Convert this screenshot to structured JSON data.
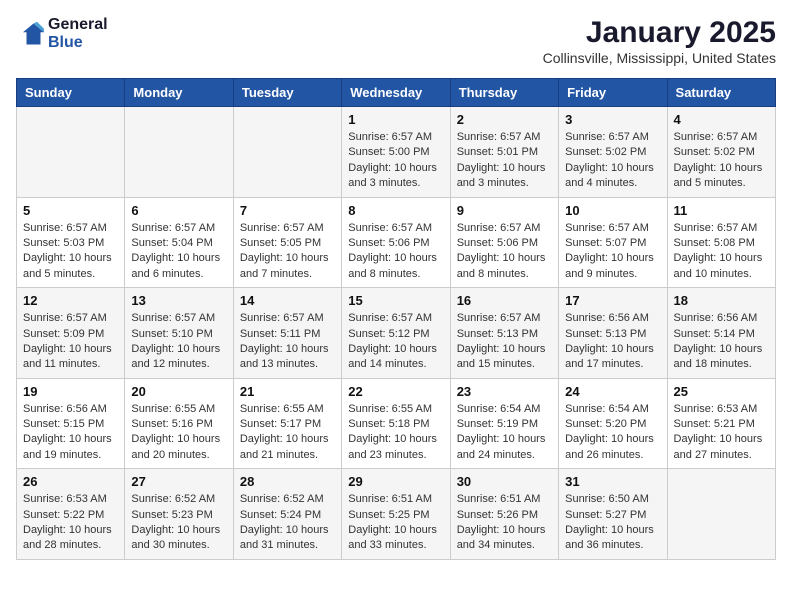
{
  "header": {
    "logo_line1": "General",
    "logo_line2": "Blue",
    "title": "January 2025",
    "subtitle": "Collinsville, Mississippi, United States"
  },
  "days_of_week": [
    "Sunday",
    "Monday",
    "Tuesday",
    "Wednesday",
    "Thursday",
    "Friday",
    "Saturday"
  ],
  "weeks": [
    [
      {
        "num": "",
        "sunrise": "",
        "sunset": "",
        "daylight": ""
      },
      {
        "num": "",
        "sunrise": "",
        "sunset": "",
        "daylight": ""
      },
      {
        "num": "",
        "sunrise": "",
        "sunset": "",
        "daylight": ""
      },
      {
        "num": "1",
        "sunrise": "Sunrise: 6:57 AM",
        "sunset": "Sunset: 5:00 PM",
        "daylight": "Daylight: 10 hours and 3 minutes."
      },
      {
        "num": "2",
        "sunrise": "Sunrise: 6:57 AM",
        "sunset": "Sunset: 5:01 PM",
        "daylight": "Daylight: 10 hours and 3 minutes."
      },
      {
        "num": "3",
        "sunrise": "Sunrise: 6:57 AM",
        "sunset": "Sunset: 5:02 PM",
        "daylight": "Daylight: 10 hours and 4 minutes."
      },
      {
        "num": "4",
        "sunrise": "Sunrise: 6:57 AM",
        "sunset": "Sunset: 5:02 PM",
        "daylight": "Daylight: 10 hours and 5 minutes."
      }
    ],
    [
      {
        "num": "5",
        "sunrise": "Sunrise: 6:57 AM",
        "sunset": "Sunset: 5:03 PM",
        "daylight": "Daylight: 10 hours and 5 minutes."
      },
      {
        "num": "6",
        "sunrise": "Sunrise: 6:57 AM",
        "sunset": "Sunset: 5:04 PM",
        "daylight": "Daylight: 10 hours and 6 minutes."
      },
      {
        "num": "7",
        "sunrise": "Sunrise: 6:57 AM",
        "sunset": "Sunset: 5:05 PM",
        "daylight": "Daylight: 10 hours and 7 minutes."
      },
      {
        "num": "8",
        "sunrise": "Sunrise: 6:57 AM",
        "sunset": "Sunset: 5:06 PM",
        "daylight": "Daylight: 10 hours and 8 minutes."
      },
      {
        "num": "9",
        "sunrise": "Sunrise: 6:57 AM",
        "sunset": "Sunset: 5:06 PM",
        "daylight": "Daylight: 10 hours and 8 minutes."
      },
      {
        "num": "10",
        "sunrise": "Sunrise: 6:57 AM",
        "sunset": "Sunset: 5:07 PM",
        "daylight": "Daylight: 10 hours and 9 minutes."
      },
      {
        "num": "11",
        "sunrise": "Sunrise: 6:57 AM",
        "sunset": "Sunset: 5:08 PM",
        "daylight": "Daylight: 10 hours and 10 minutes."
      }
    ],
    [
      {
        "num": "12",
        "sunrise": "Sunrise: 6:57 AM",
        "sunset": "Sunset: 5:09 PM",
        "daylight": "Daylight: 10 hours and 11 minutes."
      },
      {
        "num": "13",
        "sunrise": "Sunrise: 6:57 AM",
        "sunset": "Sunset: 5:10 PM",
        "daylight": "Daylight: 10 hours and 12 minutes."
      },
      {
        "num": "14",
        "sunrise": "Sunrise: 6:57 AM",
        "sunset": "Sunset: 5:11 PM",
        "daylight": "Daylight: 10 hours and 13 minutes."
      },
      {
        "num": "15",
        "sunrise": "Sunrise: 6:57 AM",
        "sunset": "Sunset: 5:12 PM",
        "daylight": "Daylight: 10 hours and 14 minutes."
      },
      {
        "num": "16",
        "sunrise": "Sunrise: 6:57 AM",
        "sunset": "Sunset: 5:13 PM",
        "daylight": "Daylight: 10 hours and 15 minutes."
      },
      {
        "num": "17",
        "sunrise": "Sunrise: 6:56 AM",
        "sunset": "Sunset: 5:13 PM",
        "daylight": "Daylight: 10 hours and 17 minutes."
      },
      {
        "num": "18",
        "sunrise": "Sunrise: 6:56 AM",
        "sunset": "Sunset: 5:14 PM",
        "daylight": "Daylight: 10 hours and 18 minutes."
      }
    ],
    [
      {
        "num": "19",
        "sunrise": "Sunrise: 6:56 AM",
        "sunset": "Sunset: 5:15 PM",
        "daylight": "Daylight: 10 hours and 19 minutes."
      },
      {
        "num": "20",
        "sunrise": "Sunrise: 6:55 AM",
        "sunset": "Sunset: 5:16 PM",
        "daylight": "Daylight: 10 hours and 20 minutes."
      },
      {
        "num": "21",
        "sunrise": "Sunrise: 6:55 AM",
        "sunset": "Sunset: 5:17 PM",
        "daylight": "Daylight: 10 hours and 21 minutes."
      },
      {
        "num": "22",
        "sunrise": "Sunrise: 6:55 AM",
        "sunset": "Sunset: 5:18 PM",
        "daylight": "Daylight: 10 hours and 23 minutes."
      },
      {
        "num": "23",
        "sunrise": "Sunrise: 6:54 AM",
        "sunset": "Sunset: 5:19 PM",
        "daylight": "Daylight: 10 hours and 24 minutes."
      },
      {
        "num": "24",
        "sunrise": "Sunrise: 6:54 AM",
        "sunset": "Sunset: 5:20 PM",
        "daylight": "Daylight: 10 hours and 26 minutes."
      },
      {
        "num": "25",
        "sunrise": "Sunrise: 6:53 AM",
        "sunset": "Sunset: 5:21 PM",
        "daylight": "Daylight: 10 hours and 27 minutes."
      }
    ],
    [
      {
        "num": "26",
        "sunrise": "Sunrise: 6:53 AM",
        "sunset": "Sunset: 5:22 PM",
        "daylight": "Daylight: 10 hours and 28 minutes."
      },
      {
        "num": "27",
        "sunrise": "Sunrise: 6:52 AM",
        "sunset": "Sunset: 5:23 PM",
        "daylight": "Daylight: 10 hours and 30 minutes."
      },
      {
        "num": "28",
        "sunrise": "Sunrise: 6:52 AM",
        "sunset": "Sunset: 5:24 PM",
        "daylight": "Daylight: 10 hours and 31 minutes."
      },
      {
        "num": "29",
        "sunrise": "Sunrise: 6:51 AM",
        "sunset": "Sunset: 5:25 PM",
        "daylight": "Daylight: 10 hours and 33 minutes."
      },
      {
        "num": "30",
        "sunrise": "Sunrise: 6:51 AM",
        "sunset": "Sunset: 5:26 PM",
        "daylight": "Daylight: 10 hours and 34 minutes."
      },
      {
        "num": "31",
        "sunrise": "Sunrise: 6:50 AM",
        "sunset": "Sunset: 5:27 PM",
        "daylight": "Daylight: 10 hours and 36 minutes."
      },
      {
        "num": "",
        "sunrise": "",
        "sunset": "",
        "daylight": ""
      }
    ]
  ]
}
